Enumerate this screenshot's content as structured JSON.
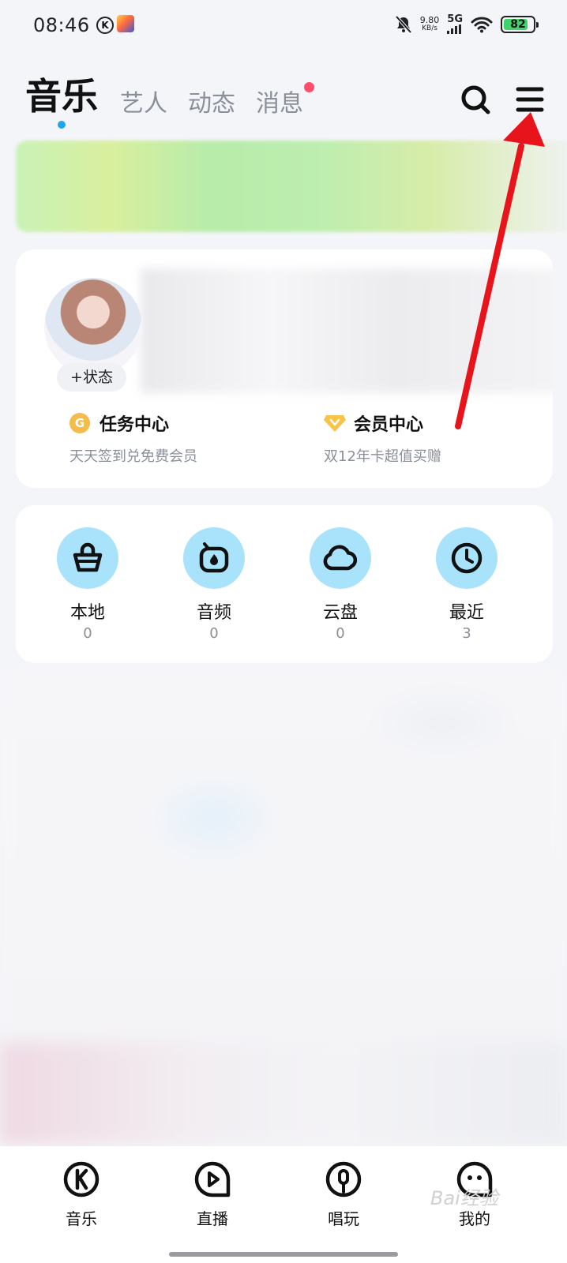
{
  "status_bar": {
    "time": "08:46",
    "k_badge": "K",
    "net_speed_value": "9.80",
    "net_speed_unit": "KB/s",
    "network": "5G",
    "battery": "82"
  },
  "top_nav": {
    "tabs": [
      {
        "label": "音乐",
        "active": true
      },
      {
        "label": "艺人",
        "active": false
      },
      {
        "label": "动态",
        "active": false
      },
      {
        "label": "消息",
        "active": false,
        "badge": true
      }
    ],
    "icons": [
      "search-icon",
      "menu-icon"
    ]
  },
  "profile": {
    "status_button": "+状态",
    "features": [
      {
        "icon": "coin-icon",
        "icon_text": "G",
        "title": "任务中心",
        "subtitle": "天天签到兑免费会员"
      },
      {
        "icon": "diamond-icon",
        "title": "会员中心",
        "subtitle": "双12年卡超值买赠"
      }
    ]
  },
  "quick_access": [
    {
      "icon": "bag-icon",
      "label": "本地",
      "count": "0"
    },
    {
      "icon": "audio-icon",
      "label": "音频",
      "count": "0"
    },
    {
      "icon": "cloud-icon",
      "label": "云盘",
      "count": "0"
    },
    {
      "icon": "clock-icon",
      "label": "最近",
      "count": "3"
    }
  ],
  "bottom_nav": [
    {
      "icon": "music-k-icon",
      "label": "音乐"
    },
    {
      "icon": "live-icon",
      "label": "直播"
    },
    {
      "icon": "sing-icon",
      "label": "唱玩"
    },
    {
      "icon": "mine-icon",
      "label": "我的"
    }
  ],
  "watermark": "Bai经验",
  "colors": {
    "accent_blue": "#1ea7f0",
    "badge_red": "#ff4d6a",
    "quick_circle": "#a9e3fb",
    "battery_green": "#3ed36b",
    "annotation_red": "#e8141b"
  }
}
